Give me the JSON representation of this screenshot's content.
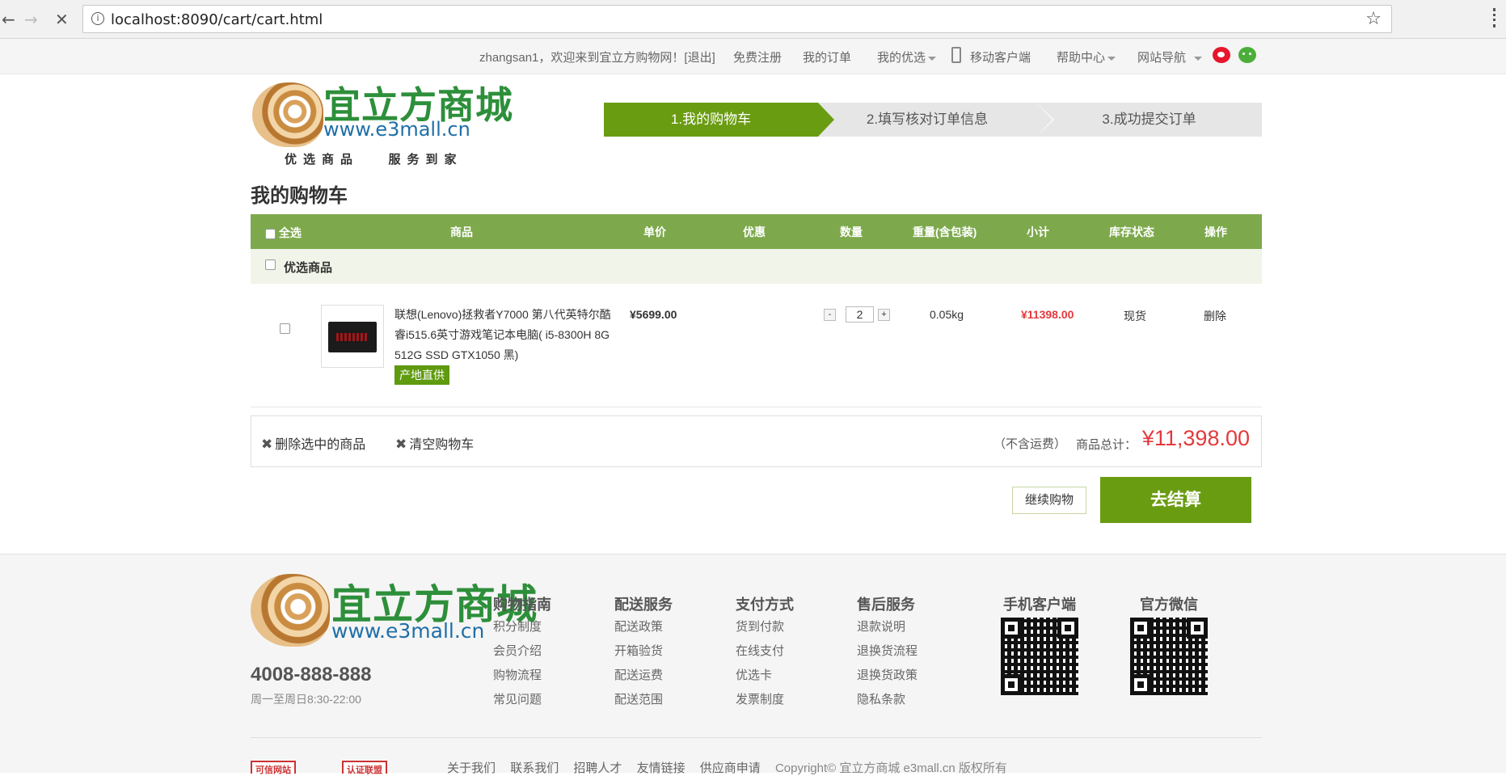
{
  "browser": {
    "url_host": "localhost",
    "url_rest": ":8090/cart/cart.html",
    "back_icon": "←",
    "forward_icon": "→",
    "stop_icon": "✕",
    "star_icon": "☆"
  },
  "topbar": {
    "welcome": "zhangsan1，欢迎来到宜立方购物网！[退出]",
    "register": "免费注册",
    "orders": "我的订单",
    "favorites": "我的优选",
    "mobile": "移动客户端",
    "help": "帮助中心",
    "sitenav": "网站导航"
  },
  "logo": {
    "cn": "宜立方商城",
    "en": "www.e3mall.cn",
    "slogan_left": "优选商品",
    "slogan_right": "服务到家"
  },
  "steps": [
    "1.我的购物车",
    "2.填写核对订单信息",
    "3.成功提交订单"
  ],
  "cart": {
    "title": "我的购物车",
    "headers": {
      "select_all": "全选",
      "product": "商品",
      "price": "单价",
      "discount": "优惠",
      "qty": "数量",
      "weight": "重量(含包装)",
      "subtotal": "小计",
      "stock": "库存状态",
      "ops": "操作"
    },
    "group": "优选商品",
    "item": {
      "name": "联想(Lenovo)拯救者Y7000 第八代英特尔酷睿i515.6英寸游戏笔记本电脑( i5-8300H 8G 512G SSD GTX1050 黑)",
      "tag": "产地直供",
      "price": "¥5699.00",
      "qty_minus": "-",
      "qty": "2",
      "qty_plus": "+",
      "weight": "0.05kg",
      "subtotal": "¥11398.00",
      "stock": "现货",
      "delete": "删除"
    },
    "bar": {
      "delete_selected": "删除选中的商品",
      "clear_cart": "清空购物车",
      "no_shipping": "（不含运费）",
      "total_label": "商品总计：",
      "total": "¥11,398.00"
    },
    "continue": "继续购物",
    "checkout": "去结算"
  },
  "footer": {
    "logo_cn": "宜立方商城",
    "logo_en": "www.e3mall.cn",
    "hotline": "4008-888-888",
    "hours": "周一至周日8:30-22:00",
    "columns": [
      {
        "title": "购物指南",
        "links": [
          "积分制度",
          "会员介绍",
          "购物流程",
          "常见问题"
        ]
      },
      {
        "title": "配送服务",
        "links": [
          "配送政策",
          "开箱验货",
          "配送运费",
          "配送范围"
        ]
      },
      {
        "title": "支付方式",
        "links": [
          "货到付款",
          "在线支付",
          "优选卡",
          "发票制度"
        ]
      },
      {
        "title": "售后服务",
        "links": [
          "退款说明",
          "退换货流程",
          "退换货政策",
          "隐私条款"
        ]
      }
    ],
    "qr_mobile": "手机客户端",
    "qr_wechat": "官方微信",
    "bottom_links": [
      "关于我们",
      "联系我们",
      "招聘人才",
      "友情链接",
      "供应商申请"
    ],
    "copyright": "Copyright© 宜立方商城 e3mall.cn 版权所有",
    "badge1": "可信网站",
    "badge2": "认证联盟"
  }
}
